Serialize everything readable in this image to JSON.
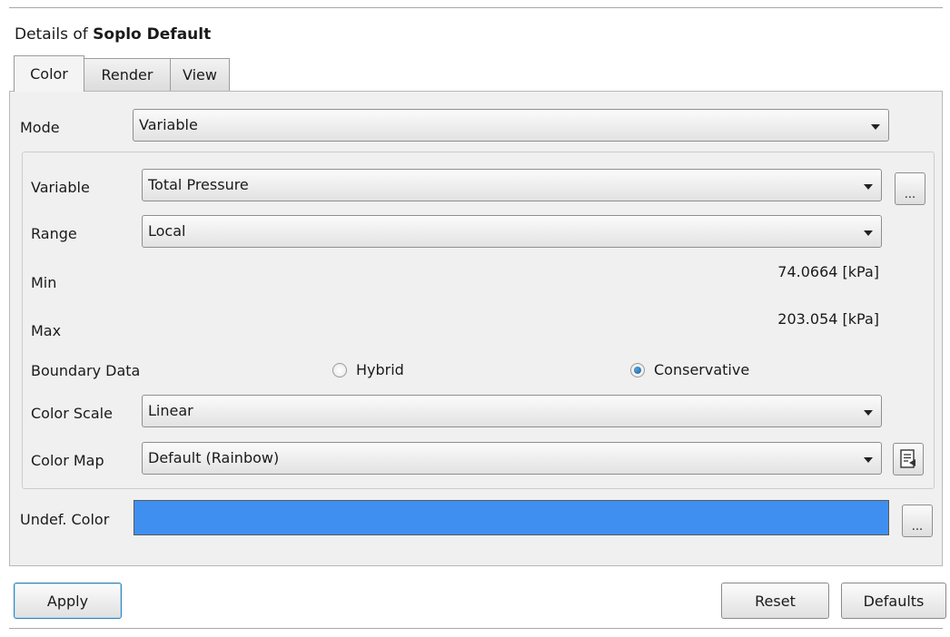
{
  "header": {
    "prefix": "Details of ",
    "object_name": "Soplo Default"
  },
  "tabs": [
    {
      "label": "Color",
      "active": true
    },
    {
      "label": "Render",
      "active": false
    },
    {
      "label": "View",
      "active": false
    }
  ],
  "color_tab": {
    "mode": {
      "label": "Mode",
      "value": "Variable"
    },
    "variable": {
      "label": "Variable",
      "value": "Total Pressure",
      "button_label": "..."
    },
    "range": {
      "label": "Range",
      "value": "Local"
    },
    "min": {
      "label": "Min",
      "value": "74.0664 [kPa]"
    },
    "max": {
      "label": "Max",
      "value": "203.054 [kPa]"
    },
    "boundary_data": {
      "label": "Boundary Data",
      "options": [
        {
          "label": "Hybrid",
          "selected": false
        },
        {
          "label": "Conservative",
          "selected": true
        }
      ]
    },
    "color_scale": {
      "label": "Color Scale",
      "value": "Linear"
    },
    "color_map": {
      "label": "Color Map",
      "value": "Default (Rainbow)",
      "button_icon": "document-edit-icon"
    },
    "undef_color": {
      "label": "Undef. Color",
      "color": "#3f8ff0",
      "button_label": "..."
    }
  },
  "footer": {
    "apply_label": "Apply",
    "reset_label": "Reset",
    "defaults_label": "Defaults"
  }
}
